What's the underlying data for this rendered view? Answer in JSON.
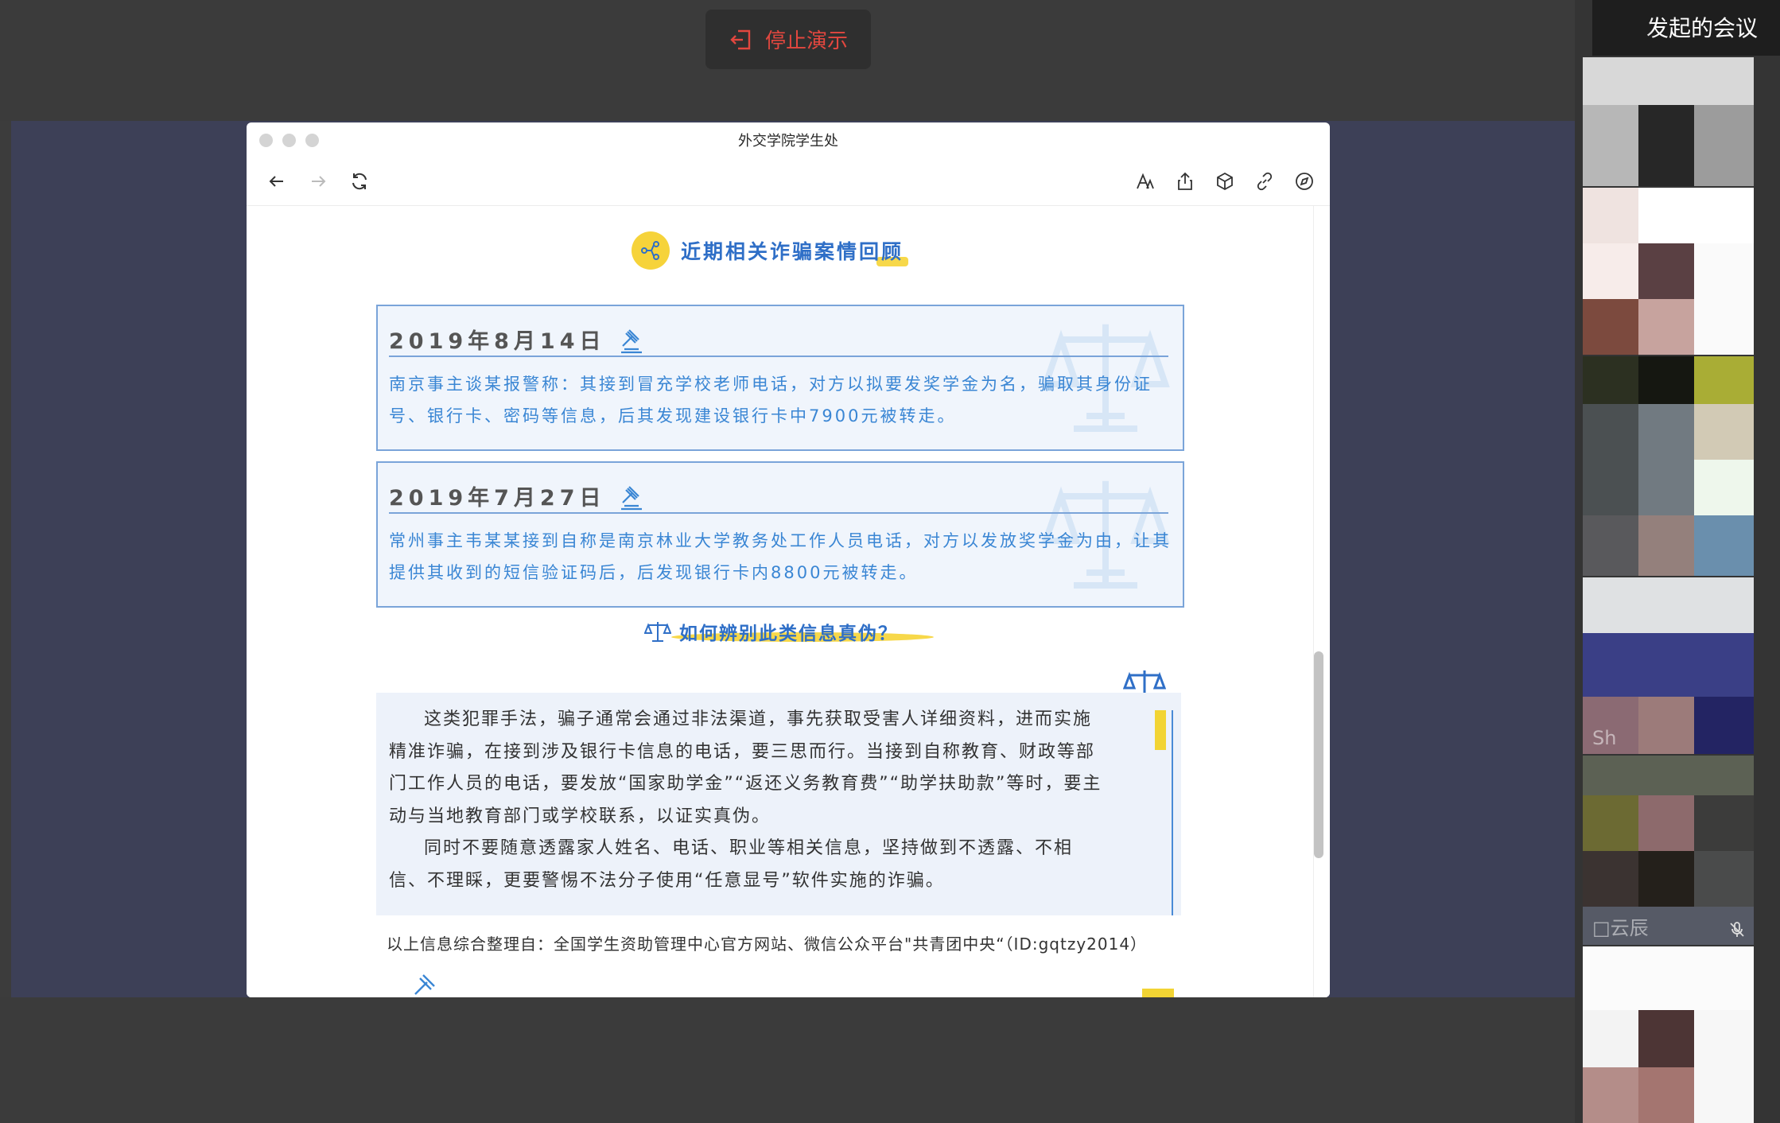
{
  "present_bar": {
    "stop_label": "停止演示"
  },
  "meeting_panel": {
    "title": "发起的会议",
    "tiles": [
      {
        "name": ""
      },
      {
        "name": ""
      },
      {
        "name": ""
      },
      {
        "name": "Sh"
      },
      {
        "name": ""
      },
      {
        "name": "□云辰"
      },
      {
        "name": ""
      }
    ]
  },
  "browser": {
    "window_title": "外交学院学生处"
  },
  "article": {
    "section1_title": "近期相关诈骗案情回顾",
    "cases": [
      {
        "date": "2019年8月14日",
        "text": "南京事主谈某报警称：其接到冒充学校老师电话，对方以拟要发奖学金为名，骗取其身份证号、银行卡、密码等信息，后其发现建设银行卡中7900元被转走。"
      },
      {
        "date": "2019年7月27日",
        "text": "常州事主韦某某接到自称是南京林业大学教务处工作人员电话，对方以发放奖学金为由，让其提供其收到的短信验证码后，后发现银行卡内8800元被转走。"
      }
    ],
    "section2_title": "如何辨别此类信息真伪？",
    "advice_p1": "这类犯罪手法，骗子通常会通过非法渠道，事先获取受害人详细资料，进而实施精准诈骗，在接到涉及银行卡信息的电话，要三思而行。当接到自称教育、财政等部门工作人员的电话，要发放“国家助学金”“返还义务教育费”“助学扶助款”等时，要主动与当地教育部门或学校联系，以证实真伪。",
    "advice_p2": "同时不要随意透露家人姓名、电话、职业等相关信息，坚持做到不透露、不相信、不理睬，更要警惕不法分子使用“任意显号”软件实施的诈骗。",
    "source": "以上信息综合整理自：全国学生资助管理中心官方网站、微信公众平台\"共青团中央“（ID:gqtzy2014）"
  },
  "colors": {
    "accent_blue": "#2f6fc7",
    "text_blue": "#3a86d4",
    "yellow": "#f6d33a",
    "stop_red": "#e2473f",
    "stage": "#3d4057"
  }
}
